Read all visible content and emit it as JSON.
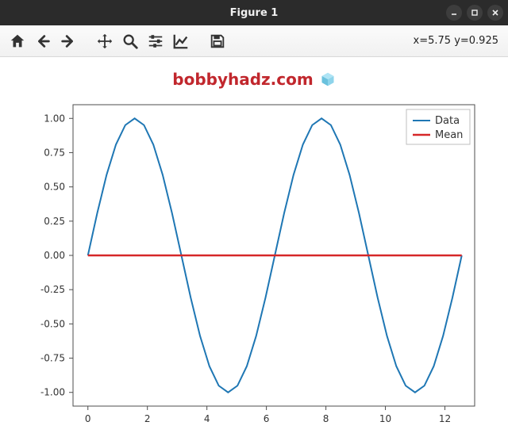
{
  "window": {
    "title": "Figure 1",
    "controls": {
      "minimize": "minimize",
      "maximize": "maximize",
      "close": "close"
    }
  },
  "toolbar": {
    "home": "Home",
    "back": "Back",
    "forward": "Forward",
    "pan": "Pan",
    "zoom": "Zoom",
    "configure": "Configure subplots",
    "edit": "Edit axis",
    "save": "Save"
  },
  "status": {
    "coords": "x=5.75 y=0.925"
  },
  "watermark": {
    "text": "bobbyhadz.com"
  },
  "legend": {
    "data": "Data",
    "mean": "Mean"
  },
  "chart_data": {
    "type": "line",
    "title": "",
    "xlabel": "",
    "ylabel": "",
    "xlim": [
      -0.5,
      13
    ],
    "ylim": [
      -1.1,
      1.1
    ],
    "xticks": [
      0,
      2,
      4,
      6,
      8,
      10,
      12
    ],
    "yticks": [
      -1.0,
      -0.75,
      -0.5,
      -0.25,
      0.0,
      0.25,
      0.5,
      0.75,
      1.0
    ],
    "series": [
      {
        "name": "Data",
        "color": "#1f77b4",
        "x": [
          0,
          0.314,
          0.628,
          0.942,
          1.257,
          1.571,
          1.885,
          2.199,
          2.513,
          2.827,
          3.142,
          3.456,
          3.77,
          4.084,
          4.398,
          4.712,
          5.027,
          5.341,
          5.655,
          5.969,
          6.283,
          6.597,
          6.912,
          7.226,
          7.54,
          7.854,
          8.168,
          8.482,
          8.796,
          9.111,
          9.425,
          9.739,
          10.053,
          10.367,
          10.681,
          10.996,
          11.31,
          11.624,
          11.938,
          12.252,
          12.566
        ],
        "y": [
          0,
          0.309,
          0.588,
          0.809,
          0.951,
          1.0,
          0.951,
          0.809,
          0.588,
          0.309,
          0,
          -0.309,
          -0.588,
          -0.809,
          -0.951,
          -1.0,
          -0.951,
          -0.809,
          -0.588,
          -0.309,
          0,
          0.309,
          0.588,
          0.809,
          0.951,
          1.0,
          0.951,
          0.809,
          0.588,
          0.309,
          0,
          -0.309,
          -0.588,
          -0.809,
          -0.951,
          -1.0,
          -0.951,
          -0.809,
          -0.588,
          -0.309,
          0
        ]
      },
      {
        "name": "Mean",
        "color": "#d62728",
        "x": [
          0,
          12.566
        ],
        "y": [
          0,
          0
        ]
      }
    ]
  }
}
